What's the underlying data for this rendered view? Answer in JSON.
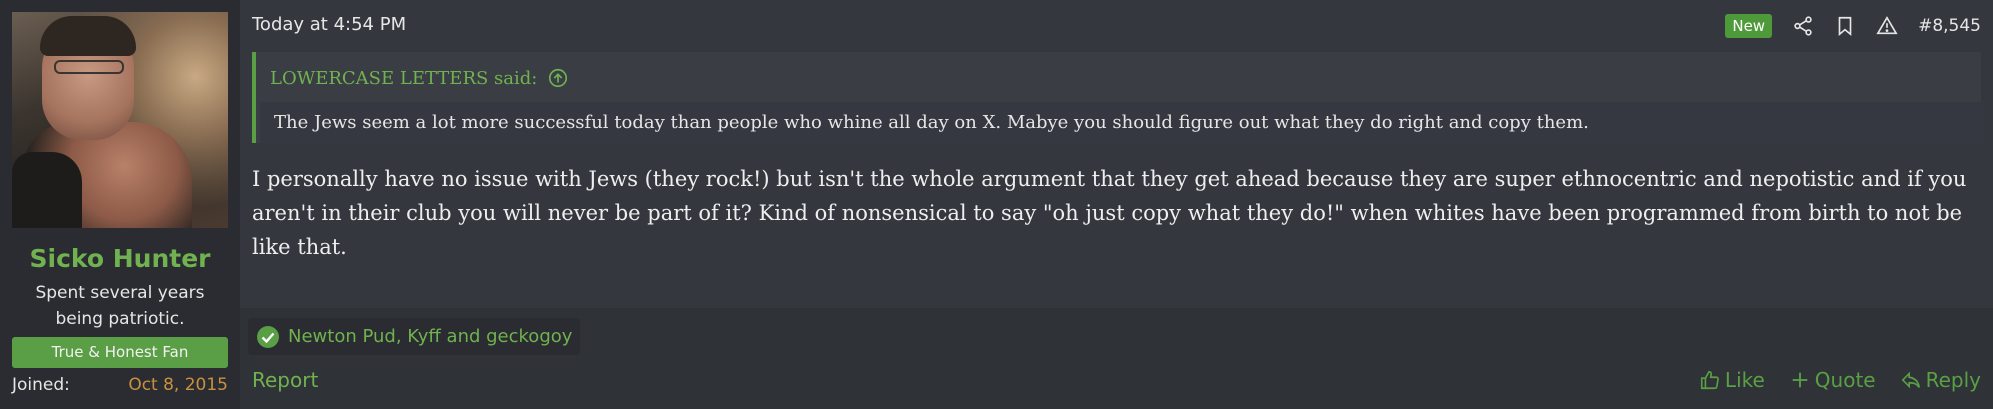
{
  "user": {
    "name": "Sicko Hunter",
    "title": "Spent several years being patriotic.",
    "banner": "True & Honest Fan",
    "joined_label": "Joined:",
    "joined_value": "Oct 8, 2015"
  },
  "post": {
    "timestamp": "Today at 4:54 PM",
    "new_badge": "New",
    "number": "#8,545",
    "quote": {
      "author": "LOWERCASE LETTERS said:",
      "text": "The Jews seem a lot more successful today than people who whine all day on X. Mabye you should figure out what they do right and copy them."
    },
    "message": "I personally have no issue with Jews (they rock!) but isn't the whole argument that they get ahead because they are super ethnocentric and nepotistic and if you aren't in their club you will never be part of it? Kind of nonsensical to say \"oh just copy what they do!\" when whites have been programmed from birth to not be like that."
  },
  "footer": {
    "reactions": "Newton Pud, Kyff and geckogoy",
    "report": "Report",
    "like": "Like",
    "quote": "Quote",
    "reply": "Reply"
  },
  "icons": {
    "share": "share-icon",
    "bookmark": "bookmark-icon",
    "report": "warning-icon",
    "quote_jump": "arrow-up-circle-icon",
    "reaction": "check-circle-icon",
    "like": "thumbs-up-icon",
    "quote_action": "plus-icon",
    "reply": "reply-icon"
  },
  "colors": {
    "accent": "#6fb24f",
    "badge": "#4e9a3a",
    "joined_date": "#c9913f",
    "background": "#34373e"
  }
}
